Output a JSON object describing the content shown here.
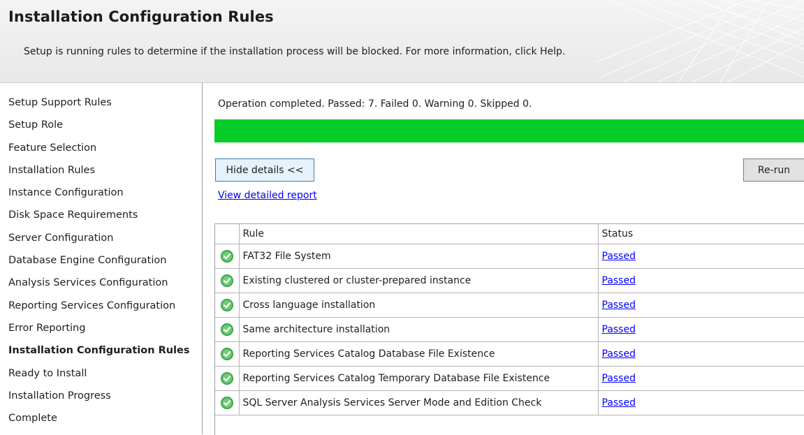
{
  "header": {
    "title": "Installation Configuration Rules",
    "subtitle": "Setup is running rules to determine if the installation process will be blocked. For more information, click Help."
  },
  "sidebar": {
    "items": [
      {
        "label": "Setup Support Rules",
        "active": false
      },
      {
        "label": "Setup Role",
        "active": false
      },
      {
        "label": "Feature Selection",
        "active": false
      },
      {
        "label": "Installation Rules",
        "active": false
      },
      {
        "label": "Instance Configuration",
        "active": false
      },
      {
        "label": "Disk Space Requirements",
        "active": false
      },
      {
        "label": "Server Configuration",
        "active": false
      },
      {
        "label": "Database Engine Configuration",
        "active": false
      },
      {
        "label": "Analysis Services Configuration",
        "active": false
      },
      {
        "label": "Reporting Services Configuration",
        "active": false
      },
      {
        "label": "Error Reporting",
        "active": false
      },
      {
        "label": "Installation Configuration Rules",
        "active": true
      },
      {
        "label": "Ready to Install",
        "active": false
      },
      {
        "label": "Installation Progress",
        "active": false
      },
      {
        "label": "Complete",
        "active": false
      }
    ]
  },
  "main": {
    "status_text": "Operation completed. Passed: 7.   Failed 0.   Warning 0.   Skipped 0.",
    "progress_fraction": 1.0,
    "hide_details_label": "Hide details <<",
    "rerun_label": "Re-run",
    "report_link": "View detailed report",
    "table": {
      "headers": {
        "rule": "Rule",
        "status": "Status"
      },
      "rows": [
        {
          "rule": "FAT32 File System",
          "status": "Passed",
          "icon": "check-circle-icon"
        },
        {
          "rule": "Existing clustered or cluster-prepared instance",
          "status": "Passed",
          "icon": "check-circle-icon"
        },
        {
          "rule": "Cross language installation",
          "status": "Passed",
          "icon": "check-circle-icon"
        },
        {
          "rule": "Same architecture installation",
          "status": "Passed",
          "icon": "check-circle-icon"
        },
        {
          "rule": "Reporting Services Catalog Database File Existence",
          "status": "Passed",
          "icon": "check-circle-icon"
        },
        {
          "rule": "Reporting Services Catalog Temporary Database File Existence",
          "status": "Passed",
          "icon": "check-circle-icon"
        },
        {
          "rule": "SQL Server Analysis Services Server Mode and Edition Check",
          "status": "Passed",
          "icon": "check-circle-icon"
        }
      ]
    }
  },
  "colors": {
    "progress_green": "#06cd28",
    "link_blue": "#0000ff",
    "check_green": "#4fb85a"
  }
}
